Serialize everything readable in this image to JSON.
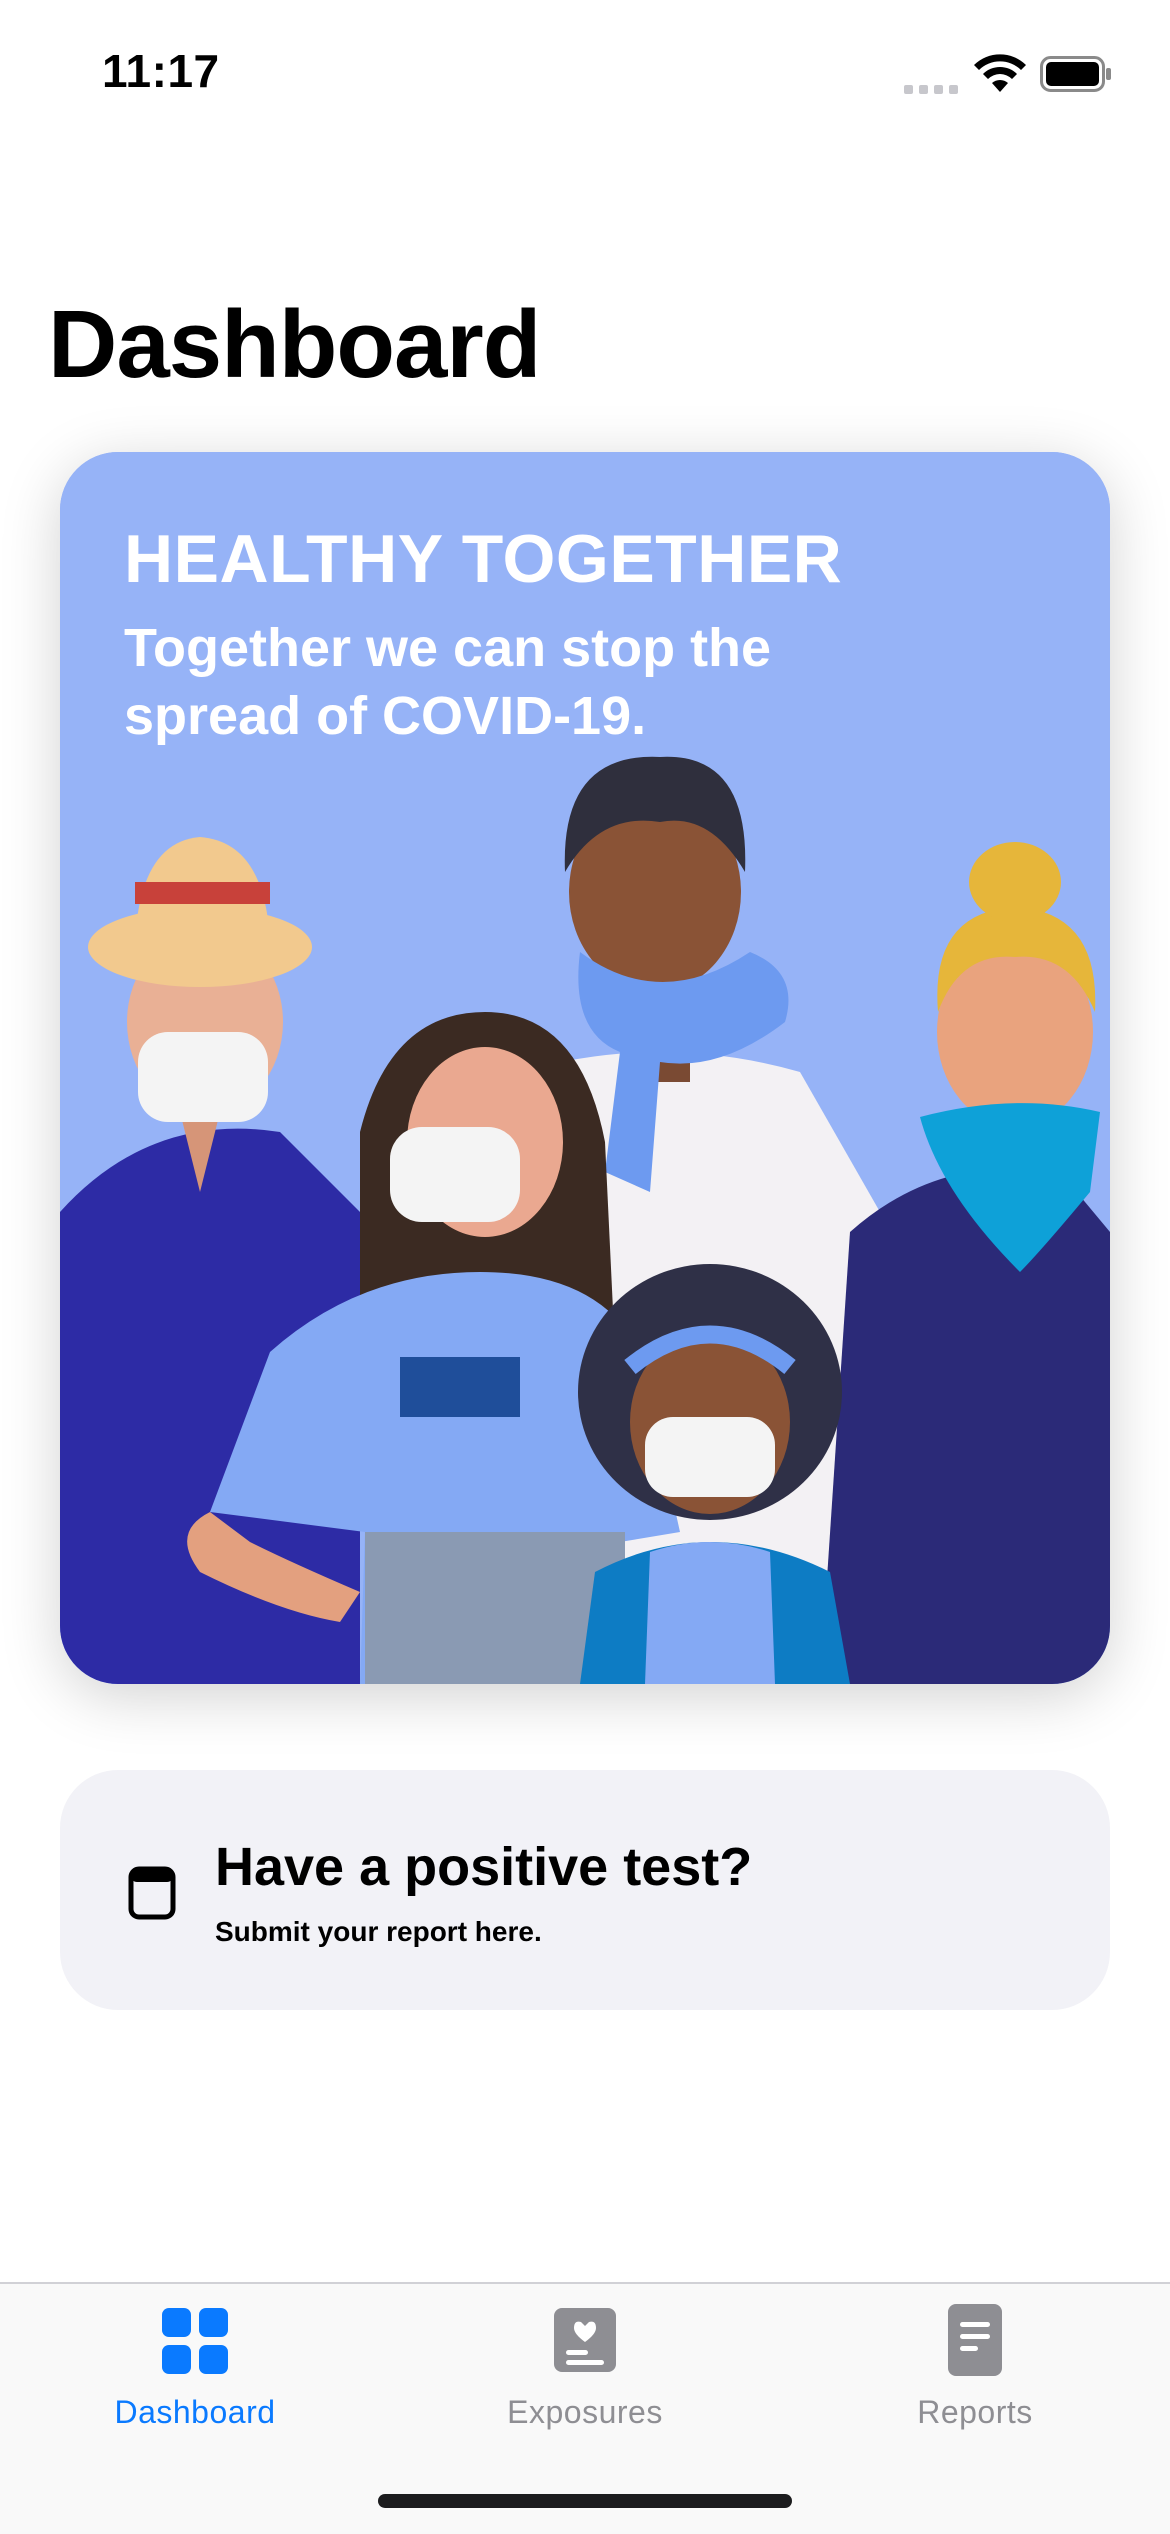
{
  "status_bar": {
    "time": "11:17"
  },
  "page": {
    "title": "Dashboard"
  },
  "hero": {
    "heading": "HEALTHY TOGETHER",
    "subheading": "Together we can stop the spread of COVID-19.",
    "background_color": "#96b3f7"
  },
  "report_card": {
    "icon": "report-icon",
    "title": "Have a positive test?",
    "subtitle": "Submit your report here."
  },
  "tab_bar": {
    "active_color": "#0a7aff",
    "inactive_color": "#8e8e93",
    "tabs": [
      {
        "label": "Dashboard",
        "icon": "dashboard-grid-icon",
        "active": true
      },
      {
        "label": "Exposures",
        "icon": "exposures-icon",
        "active": false
      },
      {
        "label": "Reports",
        "icon": "reports-document-icon",
        "active": false
      }
    ]
  }
}
